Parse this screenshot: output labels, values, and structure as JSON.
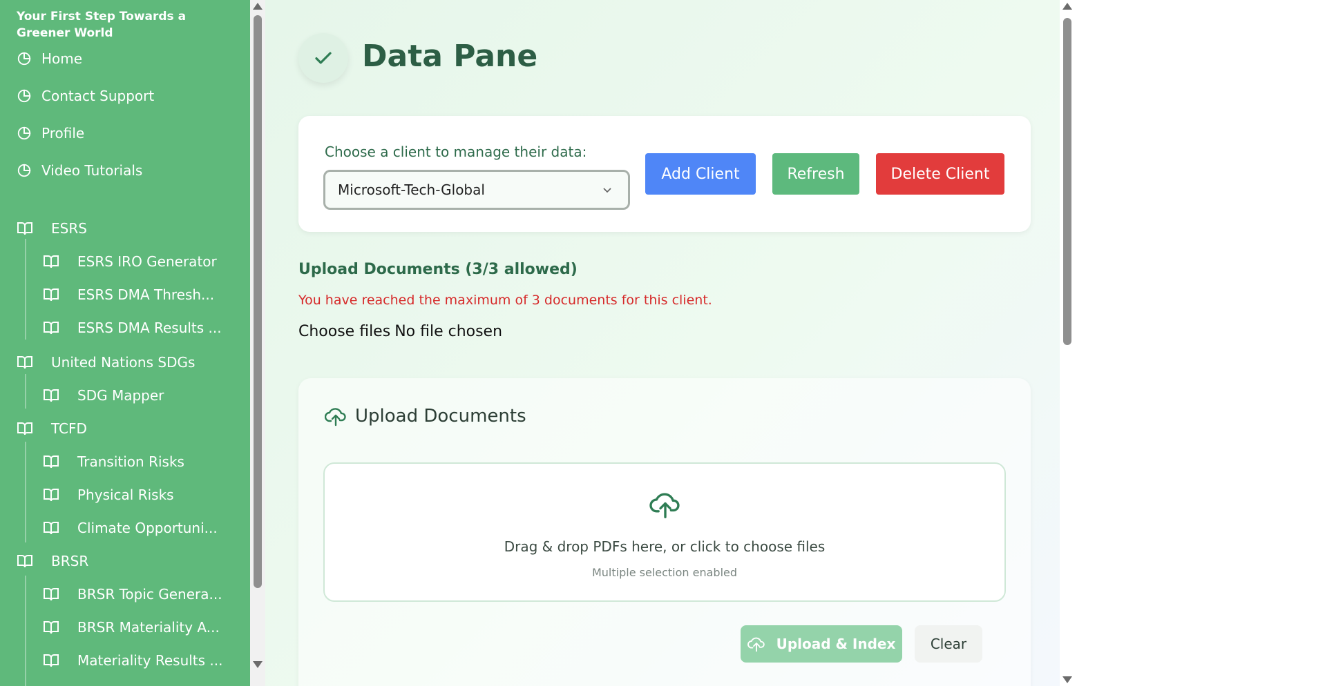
{
  "sidebar": {
    "brand": "Your First Step Towards a Greener World",
    "nav": [
      {
        "label": "Home"
      },
      {
        "label": "Contact Support"
      },
      {
        "label": "Profile"
      },
      {
        "label": "Video Tutorials"
      }
    ],
    "sections": [
      {
        "label": "ESRS",
        "items": [
          "ESRS IRO Generator",
          "ESRS DMA Thresh...",
          "ESRS DMA Results ..."
        ]
      },
      {
        "label": "United Nations SDGs",
        "items": [
          "SDG Mapper"
        ]
      },
      {
        "label": "TCFD",
        "items": [
          "Transition Risks",
          "Physical Risks",
          "Climate Opportuni..."
        ]
      },
      {
        "label": "BRSR",
        "items": [
          "BRSR Topic Genera...",
          "BRSR Materiality A...",
          "Materiality Results ..."
        ]
      }
    ]
  },
  "main": {
    "title": "Data Pane",
    "client": {
      "label": "Choose a client to manage their data:",
      "selected": "Microsoft-Tech-Global",
      "add_label": "Add Client",
      "refresh_label": "Refresh",
      "delete_label": "Delete Client"
    },
    "upload_heading": "Upload Documents (3/3 allowed)",
    "limit_message": "You have reached the maximum of 3 documents for this client.",
    "file_input": {
      "button": "Choose files",
      "status": "No file chosen"
    },
    "upload_card": {
      "title": "Upload Documents",
      "dropzone_text": "Drag & drop PDFs here, or click to choose files",
      "dropzone_sub": "Multiple selection enabled",
      "upload_label": "Upload & Index",
      "clear_label": "Clear"
    }
  },
  "colors": {
    "sidebar_bg": "#5fb97b",
    "title": "#2d5e45",
    "add": "#4f86f7",
    "refresh": "#5db97d",
    "delete": "#e23c3c",
    "error": "#d62a2a"
  }
}
